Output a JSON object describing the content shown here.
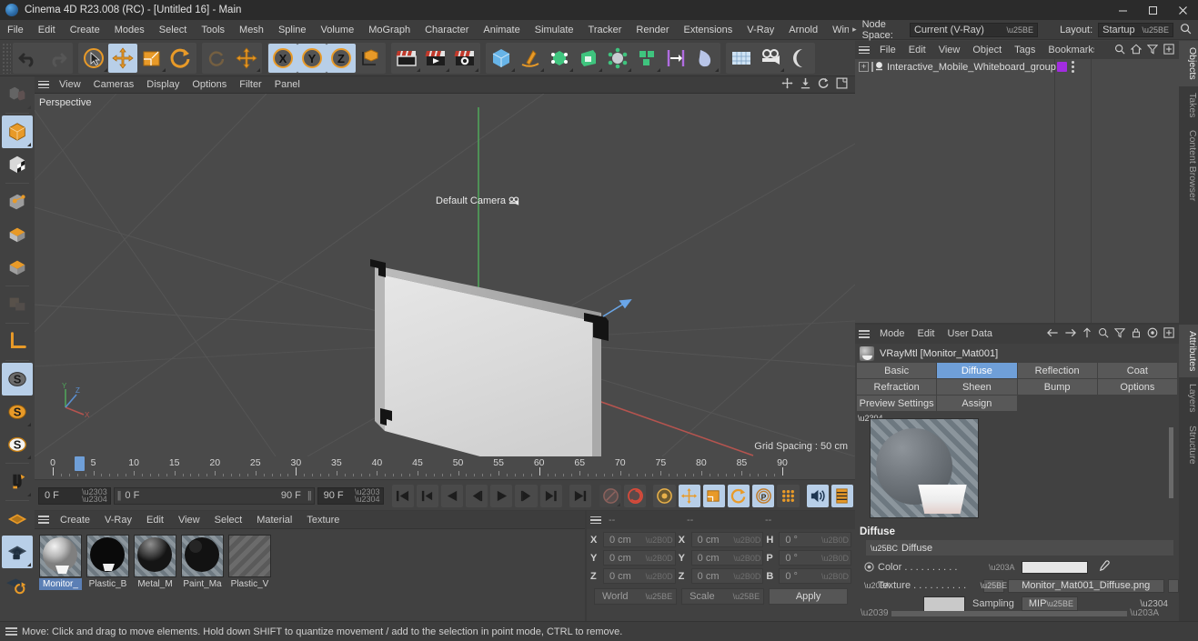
{
  "window": {
    "title": "Cinema 4D R23.008 (RC) - [Untitled 16] - Main",
    "minimize": "–",
    "maximize": "❐",
    "close": "✕"
  },
  "menubar": {
    "items": [
      "File",
      "Edit",
      "Create",
      "Modes",
      "Select",
      "Tools",
      "Mesh",
      "Spline",
      "Volume",
      "MoGraph",
      "Character",
      "Animate",
      "Simulate",
      "Tracker",
      "Render",
      "Extensions",
      "V-Ray",
      "Arnold",
      "Wind"
    ],
    "overflow_arrow": "▸",
    "node_space_label": "Node Space:",
    "node_space_value": "Current (V-Ray)",
    "layout_label": "Layout:",
    "layout_value": "Startup"
  },
  "viewport": {
    "menu": [
      "View",
      "Cameras",
      "Display",
      "Options",
      "Filter",
      "Panel"
    ],
    "label": "Perspective",
    "camera_label": "Default Camera",
    "grid_spacing": "Grid Spacing : 50 cm",
    "axis_x": "X",
    "axis_y": "Y",
    "axis_z": "Z"
  },
  "timeline": {
    "tick_labels": [
      "0",
      "5",
      "10",
      "15",
      "20",
      "25",
      "30",
      "35",
      "40",
      "45",
      "50",
      "55",
      "60",
      "65",
      "70",
      "75",
      "80",
      "85",
      "90"
    ],
    "current_frame": "0 F",
    "range_start": "0 F",
    "range_end": "90 F",
    "end_frame": "90 F",
    "preview_frame": "0 F"
  },
  "material_manager": {
    "menu": [
      "Create",
      "V-Ray",
      "Edit",
      "View",
      "Select",
      "Material",
      "Texture"
    ],
    "materials": [
      {
        "name": "Monitor_",
        "selected": true
      },
      {
        "name": "Plastic_B",
        "selected": false
      },
      {
        "name": "Metal_M",
        "selected": false
      },
      {
        "name": "Paint_Ma",
        "selected": false
      },
      {
        "name": "Plastic_V",
        "selected": false
      }
    ]
  },
  "coordinates": {
    "headers": [
      "--",
      "--",
      "--"
    ],
    "rows": [
      {
        "pos_label": "X",
        "pos_value": "0 cm",
        "size_label": "X",
        "size_value": "0 cm",
        "rot_label": "H",
        "rot_value": "0 °"
      },
      {
        "pos_label": "Y",
        "pos_value": "0 cm",
        "size_label": "Y",
        "size_value": "0 cm",
        "rot_label": "P",
        "rot_value": "0 °"
      },
      {
        "pos_label": "Z",
        "pos_value": "0 cm",
        "size_label": "Z",
        "size_value": "0 cm",
        "rot_label": "B",
        "rot_value": "0 °"
      }
    ],
    "space_value": "World",
    "mode_value": "Scale",
    "apply_label": "Apply"
  },
  "object_manager": {
    "menu": [
      "File",
      "Edit",
      "View",
      "Object",
      "Tags",
      "Bookmarks"
    ],
    "objects": [
      {
        "name": "Interactive_Mobile_Whiteboard_group"
      }
    ]
  },
  "attribute_manager": {
    "menu": [
      "Mode",
      "Edit",
      "User Data"
    ],
    "title": "VRayMtl [Monitor_Mat001]",
    "tabs_row1": [
      "Basic",
      "Diffuse",
      "Reflection",
      "Coat"
    ],
    "tabs_row2": [
      "Refraction",
      "Sheen",
      "Bump",
      "Options"
    ],
    "tabs_row3": [
      "Preview Settings",
      "Assign"
    ],
    "active_tab": "Diffuse",
    "section_title": "Diffuse",
    "group_label": "Diffuse",
    "color_label": "Color . . . . . . . . . .",
    "color_value": "#e6e6e6",
    "texture_label": "Texture . . . . . . . . . .",
    "texture_value": "Monitor_Mat001_Diffuse.png",
    "sampling_label": "Sampling",
    "sampling_value": "MIP"
  },
  "rails": {
    "top": [
      {
        "label": "Objects",
        "active": true
      },
      {
        "label": "Takes",
        "active": false
      },
      {
        "label": "Content Browser",
        "active": false
      }
    ],
    "bottom": [
      {
        "label": "Attributes",
        "active": true
      },
      {
        "label": "Layers",
        "active": false
      },
      {
        "label": "Structure",
        "active": false
      }
    ]
  },
  "statusbar": {
    "message": "Move: Click and drag to move elements. Hold down SHIFT to quantize movement / add to the selection in point mode, CTRL to remove."
  },
  "colors": {
    "accent_orange": "#e89a28",
    "selection_blue": "#b8cfe8",
    "tab_blue": "#6f9fd8",
    "tag_purple": "#a32ce0",
    "panel_bg": "#414141",
    "viewport_bg": "#4a4a4a"
  }
}
